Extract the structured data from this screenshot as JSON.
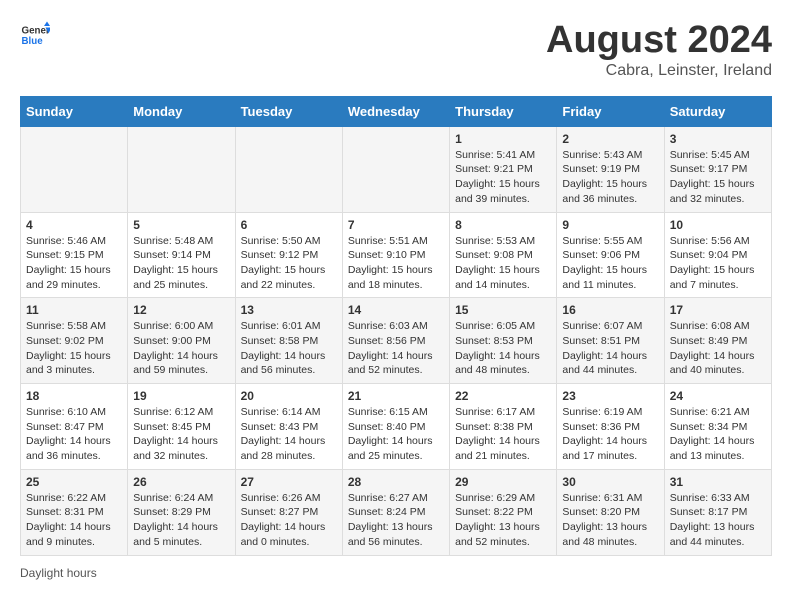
{
  "logo": {
    "general": "General",
    "blue": "Blue"
  },
  "title": "August 2024",
  "subtitle": "Cabra, Leinster, Ireland",
  "headers": [
    "Sunday",
    "Monday",
    "Tuesday",
    "Wednesday",
    "Thursday",
    "Friday",
    "Saturday"
  ],
  "weeks": [
    [
      {
        "day": "",
        "sunrise": "",
        "sunset": "",
        "daylight": ""
      },
      {
        "day": "",
        "sunrise": "",
        "sunset": "",
        "daylight": ""
      },
      {
        "day": "",
        "sunrise": "",
        "sunset": "",
        "daylight": ""
      },
      {
        "day": "",
        "sunrise": "",
        "sunset": "",
        "daylight": ""
      },
      {
        "day": "1",
        "sunrise": "Sunrise: 5:41 AM",
        "sunset": "Sunset: 9:21 PM",
        "daylight": "Daylight: 15 hours and 39 minutes."
      },
      {
        "day": "2",
        "sunrise": "Sunrise: 5:43 AM",
        "sunset": "Sunset: 9:19 PM",
        "daylight": "Daylight: 15 hours and 36 minutes."
      },
      {
        "day": "3",
        "sunrise": "Sunrise: 5:45 AM",
        "sunset": "Sunset: 9:17 PM",
        "daylight": "Daylight: 15 hours and 32 minutes."
      }
    ],
    [
      {
        "day": "4",
        "sunrise": "Sunrise: 5:46 AM",
        "sunset": "Sunset: 9:15 PM",
        "daylight": "Daylight: 15 hours and 29 minutes."
      },
      {
        "day": "5",
        "sunrise": "Sunrise: 5:48 AM",
        "sunset": "Sunset: 9:14 PM",
        "daylight": "Daylight: 15 hours and 25 minutes."
      },
      {
        "day": "6",
        "sunrise": "Sunrise: 5:50 AM",
        "sunset": "Sunset: 9:12 PM",
        "daylight": "Daylight: 15 hours and 22 minutes."
      },
      {
        "day": "7",
        "sunrise": "Sunrise: 5:51 AM",
        "sunset": "Sunset: 9:10 PM",
        "daylight": "Daylight: 15 hours and 18 minutes."
      },
      {
        "day": "8",
        "sunrise": "Sunrise: 5:53 AM",
        "sunset": "Sunset: 9:08 PM",
        "daylight": "Daylight: 15 hours and 14 minutes."
      },
      {
        "day": "9",
        "sunrise": "Sunrise: 5:55 AM",
        "sunset": "Sunset: 9:06 PM",
        "daylight": "Daylight: 15 hours and 11 minutes."
      },
      {
        "day": "10",
        "sunrise": "Sunrise: 5:56 AM",
        "sunset": "Sunset: 9:04 PM",
        "daylight": "Daylight: 15 hours and 7 minutes."
      }
    ],
    [
      {
        "day": "11",
        "sunrise": "Sunrise: 5:58 AM",
        "sunset": "Sunset: 9:02 PM",
        "daylight": "Daylight: 15 hours and 3 minutes."
      },
      {
        "day": "12",
        "sunrise": "Sunrise: 6:00 AM",
        "sunset": "Sunset: 9:00 PM",
        "daylight": "Daylight: 14 hours and 59 minutes."
      },
      {
        "day": "13",
        "sunrise": "Sunrise: 6:01 AM",
        "sunset": "Sunset: 8:58 PM",
        "daylight": "Daylight: 14 hours and 56 minutes."
      },
      {
        "day": "14",
        "sunrise": "Sunrise: 6:03 AM",
        "sunset": "Sunset: 8:56 PM",
        "daylight": "Daylight: 14 hours and 52 minutes."
      },
      {
        "day": "15",
        "sunrise": "Sunrise: 6:05 AM",
        "sunset": "Sunset: 8:53 PM",
        "daylight": "Daylight: 14 hours and 48 minutes."
      },
      {
        "day": "16",
        "sunrise": "Sunrise: 6:07 AM",
        "sunset": "Sunset: 8:51 PM",
        "daylight": "Daylight: 14 hours and 44 minutes."
      },
      {
        "day": "17",
        "sunrise": "Sunrise: 6:08 AM",
        "sunset": "Sunset: 8:49 PM",
        "daylight": "Daylight: 14 hours and 40 minutes."
      }
    ],
    [
      {
        "day": "18",
        "sunrise": "Sunrise: 6:10 AM",
        "sunset": "Sunset: 8:47 PM",
        "daylight": "Daylight: 14 hours and 36 minutes."
      },
      {
        "day": "19",
        "sunrise": "Sunrise: 6:12 AM",
        "sunset": "Sunset: 8:45 PM",
        "daylight": "Daylight: 14 hours and 32 minutes."
      },
      {
        "day": "20",
        "sunrise": "Sunrise: 6:14 AM",
        "sunset": "Sunset: 8:43 PM",
        "daylight": "Daylight: 14 hours and 28 minutes."
      },
      {
        "day": "21",
        "sunrise": "Sunrise: 6:15 AM",
        "sunset": "Sunset: 8:40 PM",
        "daylight": "Daylight: 14 hours and 25 minutes."
      },
      {
        "day": "22",
        "sunrise": "Sunrise: 6:17 AM",
        "sunset": "Sunset: 8:38 PM",
        "daylight": "Daylight: 14 hours and 21 minutes."
      },
      {
        "day": "23",
        "sunrise": "Sunrise: 6:19 AM",
        "sunset": "Sunset: 8:36 PM",
        "daylight": "Daylight: 14 hours and 17 minutes."
      },
      {
        "day": "24",
        "sunrise": "Sunrise: 6:21 AM",
        "sunset": "Sunset: 8:34 PM",
        "daylight": "Daylight: 14 hours and 13 minutes."
      }
    ],
    [
      {
        "day": "25",
        "sunrise": "Sunrise: 6:22 AM",
        "sunset": "Sunset: 8:31 PM",
        "daylight": "Daylight: 14 hours and 9 minutes."
      },
      {
        "day": "26",
        "sunrise": "Sunrise: 6:24 AM",
        "sunset": "Sunset: 8:29 PM",
        "daylight": "Daylight: 14 hours and 5 minutes."
      },
      {
        "day": "27",
        "sunrise": "Sunrise: 6:26 AM",
        "sunset": "Sunset: 8:27 PM",
        "daylight": "Daylight: 14 hours and 0 minutes."
      },
      {
        "day": "28",
        "sunrise": "Sunrise: 6:27 AM",
        "sunset": "Sunset: 8:24 PM",
        "daylight": "Daylight: 13 hours and 56 minutes."
      },
      {
        "day": "29",
        "sunrise": "Sunrise: 6:29 AM",
        "sunset": "Sunset: 8:22 PM",
        "daylight": "Daylight: 13 hours and 52 minutes."
      },
      {
        "day": "30",
        "sunrise": "Sunrise: 6:31 AM",
        "sunset": "Sunset: 8:20 PM",
        "daylight": "Daylight: 13 hours and 48 minutes."
      },
      {
        "day": "31",
        "sunrise": "Sunrise: 6:33 AM",
        "sunset": "Sunset: 8:17 PM",
        "daylight": "Daylight: 13 hours and 44 minutes."
      }
    ]
  ],
  "footer": "Daylight hours"
}
